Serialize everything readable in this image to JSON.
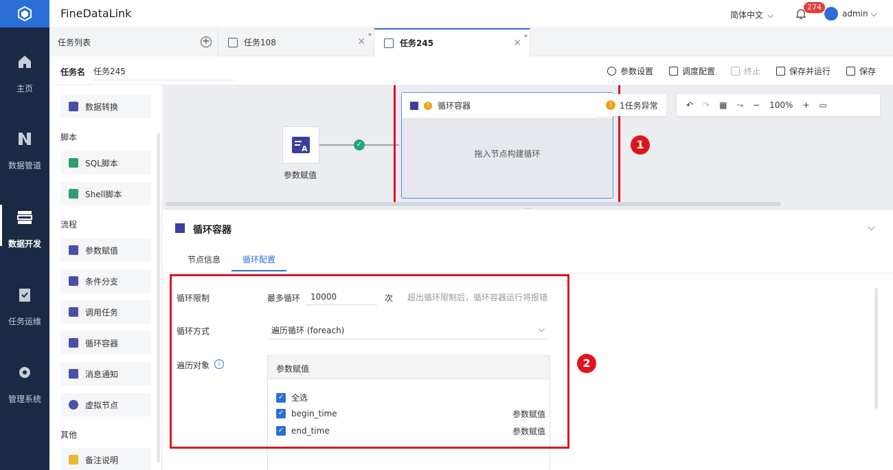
{
  "app": {
    "title": "FineDataLink",
    "language": "简体中文",
    "notifications": "274",
    "user": "admin"
  },
  "nav": [
    {
      "label": "主页",
      "icon": "home-icon"
    },
    {
      "label": "数据管道",
      "icon": "pipeline-icon"
    },
    {
      "label": "数据开发",
      "icon": "dev-icon",
      "active": true
    },
    {
      "label": "任务运维",
      "icon": "clipboard-icon"
    },
    {
      "label": "管理系统",
      "icon": "gear-icon"
    }
  ],
  "tabs": {
    "task_list": "任务列表",
    "items": [
      {
        "label": "任务108",
        "modified": "*"
      },
      {
        "label": "任务245",
        "modified": "*",
        "active": true
      }
    ]
  },
  "toolbar": {
    "task_name_label": "任务名",
    "task_name_value": "任务245",
    "buttons": [
      "参数设置",
      "调度配置",
      "终止",
      "保存并运行",
      "保存"
    ]
  },
  "components": {
    "top": "数据转换",
    "sections": [
      {
        "title": "脚本",
        "items": [
          "SQL脚本",
          "Shell脚本"
        ]
      },
      {
        "title": "流程",
        "items": [
          "参数赋值",
          "条件分支",
          "调用任务",
          "循环容器",
          "消息通知",
          "虚拟节点"
        ]
      },
      {
        "title": "其他",
        "items": [
          "备注说明"
        ]
      }
    ]
  },
  "canvas": {
    "node_label": "参数赋值",
    "loop_title": "循环容器",
    "loop_hint": "拖入节点构建循环",
    "warning": "1任务异常",
    "zoom": "100%",
    "badge1": "1",
    "badge2": "2"
  },
  "config": {
    "title": "循环容器",
    "tabs": [
      "节点信息",
      "循环配置"
    ],
    "limit_label": "循环限制",
    "max_label": "最多循环",
    "max_value": "10000",
    "unit": "次",
    "limit_hint": "超出循环限制后，循环容器运行将报错",
    "mode_label": "循环方式",
    "mode_value": "遍历循环 (foreach)",
    "iter_label": "遍历对象",
    "iter_header": "参数赋值",
    "checks": [
      {
        "label": "全选",
        "source": ""
      },
      {
        "label": "begin_time",
        "source": "参数赋值"
      },
      {
        "label": "end_time",
        "source": "参数赋值"
      }
    ]
  },
  "colors": {
    "nav_bg": "#1b2a44",
    "accent": "#2b6fd6",
    "highlight": "#e0141c",
    "success": "#24a67a",
    "warning": "#f0a020"
  }
}
